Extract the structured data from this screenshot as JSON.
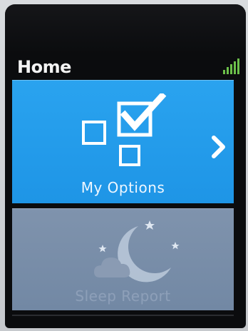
{
  "header": {
    "title": "Home",
    "signal_icon": "signal-strength-icon",
    "signal_color": "#6cc04a",
    "signal_bars": 5
  },
  "tiles": [
    {
      "label": "My Options",
      "icon": "checklist-icon",
      "arrow_icon": "chevron-right-icon",
      "background": "#2aa3ef"
    },
    {
      "label": "Sleep Report",
      "icon": "moon-stars-cloud-icon",
      "background": "#7f93ad"
    }
  ]
}
